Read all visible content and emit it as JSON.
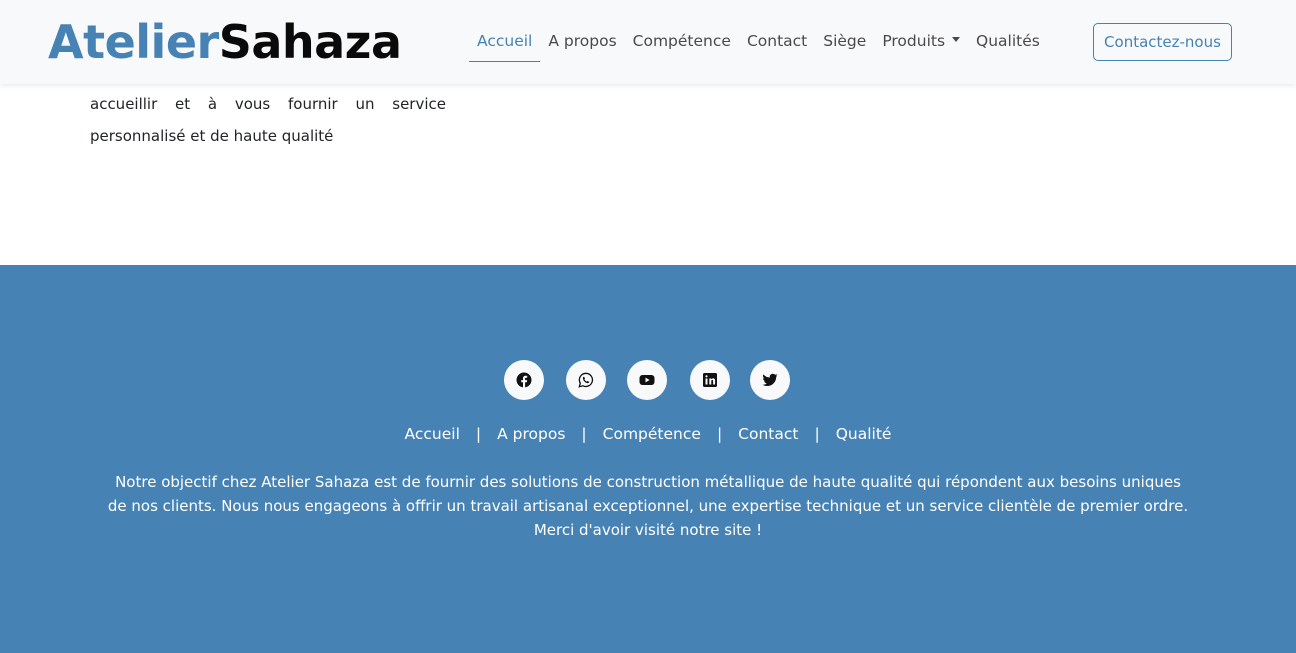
{
  "brand": {
    "part1": "Atelier",
    "part2": "Sahaza"
  },
  "nav": {
    "items": [
      {
        "label": "Accueil",
        "active": true
      },
      {
        "label": "A propos"
      },
      {
        "label": "Compétence"
      },
      {
        "label": "Contact"
      },
      {
        "label": "Siège"
      },
      {
        "label": "Produits",
        "dropdown": true
      },
      {
        "label": "Qualités"
      }
    ],
    "cta_label": "Contactez-nous"
  },
  "content": {
    "line1": "accueillir et à vous fournir un service",
    "line2": "personnalisé et de haute qualité"
  },
  "footer": {
    "socials": [
      {
        "icon": "facebook-icon"
      },
      {
        "icon": "whatsapp-icon"
      },
      {
        "icon": "youtube-icon"
      },
      {
        "icon": "linkedin-icon"
      },
      {
        "icon": "twitter-icon"
      }
    ],
    "links": [
      "Accueil",
      "A propos",
      "Compétence",
      "Contact",
      "Qualité"
    ],
    "separator": "|",
    "text": "Notre objectif chez Atelier Sahaza est de fournir des solutions de construction métallique de haute qualité qui répondent aux besoins uniques de nos clients. Nous nous engageons à offrir un travail artisanal exceptionnel, une expertise technique et un service clientèle de premier ordre. Merci d'avoir visité notre site !"
  },
  "colors": {
    "accent": "#4682b4",
    "navbar_bg": "#f8f9fa",
    "footer_bg": "#4682b4"
  }
}
